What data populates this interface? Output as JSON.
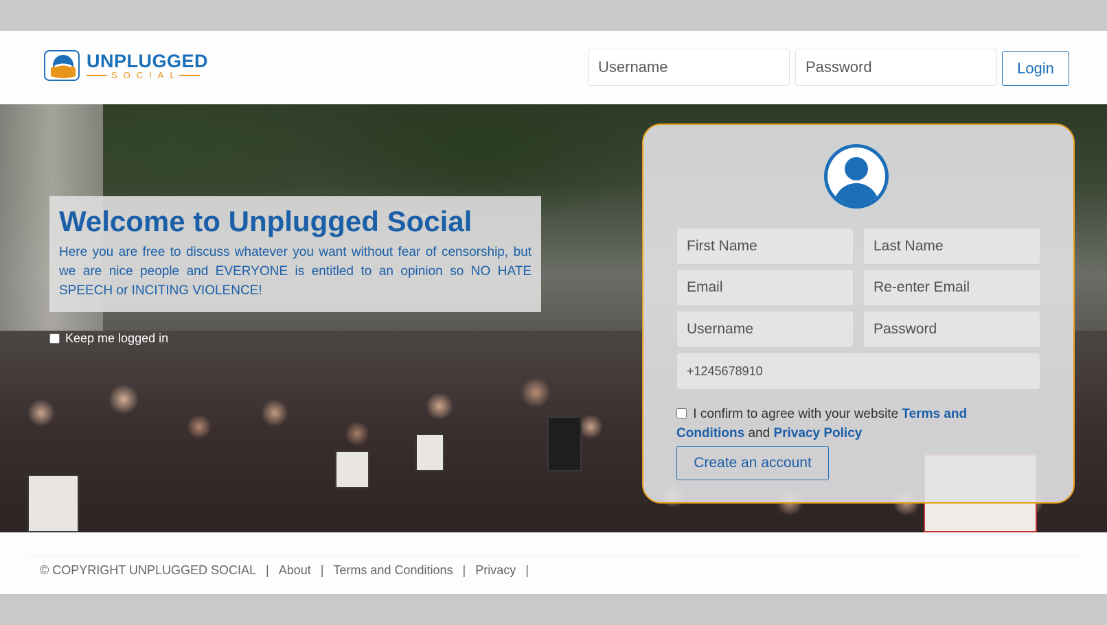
{
  "header": {
    "logo_main": "UNPLUGGED",
    "logo_sub": "SOCIAL",
    "username_placeholder": "Username",
    "password_placeholder": "Password",
    "login_label": "Login"
  },
  "hero": {
    "welcome_title": "Welcome to Unplugged Social",
    "welcome_body": "Here you are free to discuss whatever you want without fear of censorship, but we are nice people and EVERYONE is entitled to an opinion so NO HATE SPEECH or INCITING VIOLENCE!",
    "keep_logged_in": "Keep me logged in"
  },
  "register": {
    "first_name": "First Name",
    "last_name": "Last Name",
    "email": "Email",
    "reenter_email": "Re-enter Email",
    "username": "Username",
    "password": "Password",
    "phone": "+1245678910",
    "terms_prefix": "I confirm to agree with your website",
    "terms_link": "Terms and Conditions",
    "terms_and": "and",
    "privacy_link": "Privacy Policy",
    "create_label": "Create an account"
  },
  "footer": {
    "copyright": "© COPYRIGHT UNPLUGGED SOCIAL",
    "links": [
      "About",
      "Terms and Conditions",
      "Privacy"
    ],
    "separator": "|"
  },
  "colors": {
    "brand_blue": "#1b6fb8",
    "brand_orange": "#e8951c"
  }
}
